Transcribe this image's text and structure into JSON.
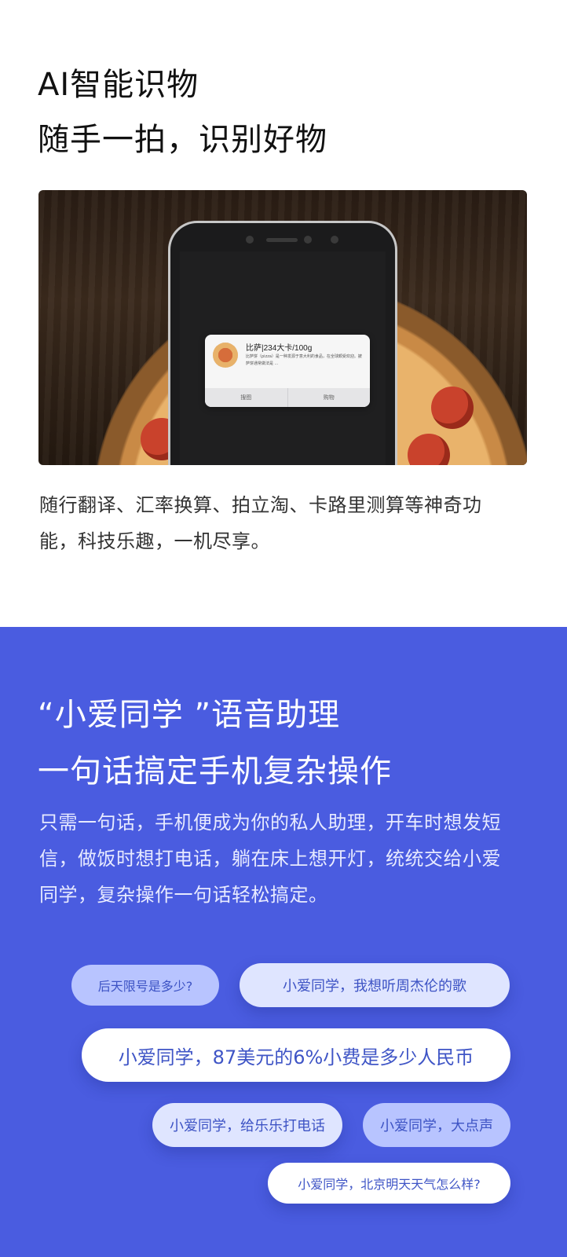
{
  "section1": {
    "title_line1": "AI智能识物",
    "title_line2": "随手一拍，识别好物",
    "card": {
      "title": "比萨|234大卡/100g",
      "desc": "比萨饼（pizza）是一种发源于意大利的食品，在全球颇受欢迎。披萨饼通常做法是 ...",
      "action_left": "搜图",
      "action_right": "购物"
    },
    "paragraph": "随行翻译、汇率换算、拍立淘、卡路里测算等神奇功能，科技乐趣，一机尽享。"
  },
  "section2": {
    "title_line1": "“小爱同学 ”语音助理",
    "title_line2": "一句话搞定手机复杂操作",
    "paragraph": "只需一句话，手机便成为你的私人助理，开车时想发短信，做饭时想打电话，躺在床上想开灯，统统交给小爱同学，复杂操作一句话轻松搞定。",
    "bubbles": {
      "b1": "后天限号是多少?",
      "b2": "小爱同学，我想听周杰伦的歌",
      "b3": "小爱同学，87美元的6%小费是多少人民币",
      "b4": "小爱同学，给乐乐打电话",
      "b5": "小爱同学，大点声",
      "b6": "小爱同学，北京明天天气怎么样?"
    }
  },
  "colors": {
    "blue_section": "#4a5ce0",
    "bubble_text": "#3f55c6",
    "bubble_soft": "#b8c4ff",
    "bubble_light": "#dfe5ff"
  }
}
